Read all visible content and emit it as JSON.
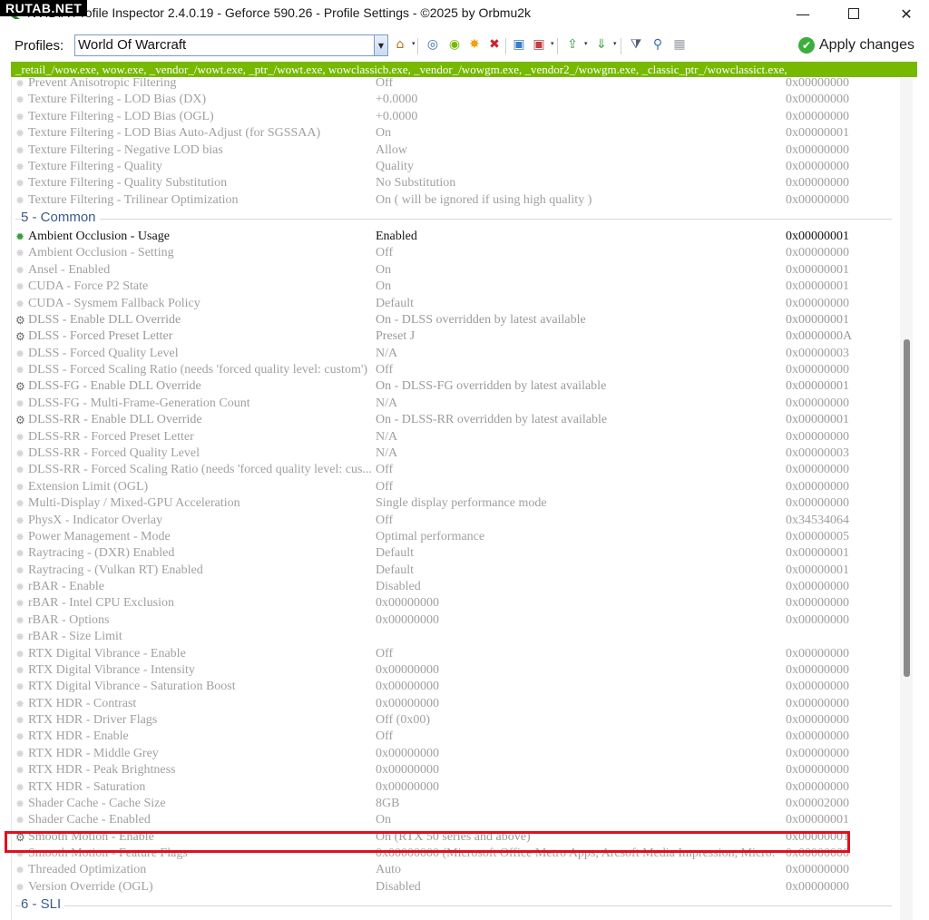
{
  "watermark": "RUTAB.NET",
  "window": {
    "title": "NVIDIA Profile Inspector 2.4.0.19 - Geforce 590.26 - Profile Settings - ©2025 by Orbmu2k",
    "min_glyph": "—",
    "close_glyph": "✕"
  },
  "toolbar": {
    "profiles_label": "Profiles:",
    "profile_value": "World Of Warcraft",
    "combo_arrow": "▼",
    "apply_label": "Apply changes",
    "apply_glyph": "✔",
    "icons": [
      {
        "name": "home-icon",
        "glyph": "⌂",
        "color": "#b07020",
        "dropdown": true
      },
      {
        "name": "detect-profile-icon",
        "glyph": "◎",
        "color": "#3a6ea8",
        "dropdown": false
      },
      {
        "name": "nvidia-icon",
        "glyph": "◉",
        "color": "#76b900",
        "dropdown": false
      },
      {
        "name": "new-profile-icon",
        "glyph": "✸",
        "color": "#f0a010",
        "dropdown": false
      },
      {
        "name": "delete-profile-icon",
        "glyph": "✖",
        "color": "#d0202a",
        "dropdown": false
      },
      {
        "name": "add-application-icon",
        "glyph": "▣",
        "color": "#3a7ec8",
        "dropdown": false
      },
      {
        "name": "remove-application-icon",
        "glyph": "▣",
        "color": "#c04040",
        "dropdown": true
      },
      {
        "name": "export-icon",
        "glyph": "⇪",
        "color": "#3aa040",
        "dropdown": true
      },
      {
        "name": "import-icon",
        "glyph": "⇓",
        "color": "#3aa040",
        "dropdown": true
      },
      {
        "name": "filter-icon",
        "glyph": "⧩",
        "color": "#506070",
        "dropdown": false
      },
      {
        "name": "scan-icon",
        "glyph": "⚲",
        "color": "#3a6ea8",
        "dropdown": false
      },
      {
        "name": "bit-editor-icon",
        "glyph": "▦",
        "color": "#9aa0a8",
        "dropdown": false
      }
    ]
  },
  "executables": "_retail_/wow.exe, wow.exe, _vendor_/wowt.exe, _ptr_/wowt.exe, wowclassicb.exe, _vendor_/wowgm.exe, _vendor2_/wowgm.exe, _classic_ptr_/wowclassict.exe,",
  "settings": {
    "icons": {
      "dim": "✹",
      "active": "✹",
      "gear": "⚙"
    },
    "top_rows": [
      {
        "name": "Prevent Anisotropic Filtering",
        "value": "Off",
        "hex": "0x00000000",
        "state": "dim"
      },
      {
        "name": "Texture Filtering - LOD Bias (DX)",
        "value": "+0.0000",
        "hex": "0x00000000",
        "state": "dim"
      },
      {
        "name": "Texture Filtering - LOD Bias (OGL)",
        "value": "+0.0000",
        "hex": "0x00000000",
        "state": "dim"
      },
      {
        "name": "Texture Filtering - LOD Bias Auto-Adjust (for SGSSAA)",
        "value": "On",
        "hex": "0x00000001",
        "state": "dim"
      },
      {
        "name": "Texture Filtering - Negative LOD bias",
        "value": "Allow",
        "hex": "0x00000000",
        "state": "dim"
      },
      {
        "name": "Texture Filtering - Quality",
        "value": "Quality",
        "hex": "0x00000000",
        "state": "dim"
      },
      {
        "name": "Texture Filtering - Quality Substitution",
        "value": "No Substitution",
        "hex": "0x00000000",
        "state": "dim"
      },
      {
        "name": "Texture Filtering - Trilinear Optimization",
        "value": "On ( will be ignored if using high quality )",
        "hex": "0x00000000",
        "state": "dim"
      }
    ],
    "group_common": "5 - Common",
    "common_rows": [
      {
        "name": "Ambient Occlusion  - Usage",
        "value": "Enabled",
        "hex": "0x00000001",
        "state": "active"
      },
      {
        "name": "Ambient Occlusion - Setting",
        "value": "Off",
        "hex": "0x00000000",
        "state": "dim"
      },
      {
        "name": "Ansel - Enabled",
        "value": "On",
        "hex": "0x00000001",
        "state": "dim"
      },
      {
        "name": "CUDA - Force P2 State",
        "value": "On",
        "hex": "0x00000001",
        "state": "dim"
      },
      {
        "name": "CUDA - Sysmem Fallback Policy",
        "value": "Default",
        "hex": "0x00000000",
        "state": "dim"
      },
      {
        "name": "DLSS - Enable DLL Override",
        "value": "On - DLSS overridden by latest available",
        "hex": "0x00000001",
        "state": "gear"
      },
      {
        "name": "DLSS - Forced Preset Letter",
        "value": "Preset J",
        "hex": "0x0000000A",
        "state": "gear"
      },
      {
        "name": "DLSS - Forced Quality Level",
        "value": "N/A",
        "hex": "0x00000003",
        "state": "dim"
      },
      {
        "name": "DLSS - Forced Scaling Ratio (needs 'forced quality level: custom')",
        "value": "Off",
        "hex": "0x00000000",
        "state": "dim"
      },
      {
        "name": "DLSS-FG - Enable DLL Override",
        "value": "On - DLSS-FG overridden by latest available",
        "hex": "0x00000001",
        "state": "gear"
      },
      {
        "name": "DLSS-FG - Multi-Frame-Generation Count",
        "value": "N/A",
        "hex": "0x00000000",
        "state": "dim"
      },
      {
        "name": "DLSS-RR - Enable DLL Override",
        "value": "On - DLSS-RR overridden by latest available",
        "hex": "0x00000001",
        "state": "gear"
      },
      {
        "name": "DLSS-RR - Forced Preset Letter",
        "value": "N/A",
        "hex": "0x00000000",
        "state": "dim"
      },
      {
        "name": "DLSS-RR - Forced Quality Level",
        "value": "N/A",
        "hex": "0x00000003",
        "state": "dim"
      },
      {
        "name": "DLSS-RR - Forced Scaling Ratio (needs 'forced quality level: cus...",
        "value": "Off",
        "hex": "0x00000000",
        "state": "dim"
      },
      {
        "name": "Extension Limit (OGL)",
        "value": "Off",
        "hex": "0x00000000",
        "state": "dim"
      },
      {
        "name": "Multi-Display / Mixed-GPU Acceleration",
        "value": "Single display performance mode",
        "hex": "0x00000000",
        "state": "dim"
      },
      {
        "name": "PhysX - Indicator Overlay",
        "value": "Off",
        "hex": "0x34534064",
        "state": "dim"
      },
      {
        "name": "Power Management - Mode",
        "value": "Optimal performance",
        "hex": "0x00000005",
        "state": "dim"
      },
      {
        "name": "Raytracing - (DXR) Enabled",
        "value": "Default",
        "hex": "0x00000001",
        "state": "dim"
      },
      {
        "name": "Raytracing - (Vulkan RT) Enabled",
        "value": "Default",
        "hex": "0x00000001",
        "state": "dim"
      },
      {
        "name": "rBAR - Enable",
        "value": "Disabled",
        "hex": "0x00000000",
        "state": "dim"
      },
      {
        "name": "rBAR - Intel CPU Exclusion",
        "value": "0x00000000",
        "hex": "0x00000000",
        "state": "dim"
      },
      {
        "name": "rBAR - Options",
        "value": "0x00000000",
        "hex": "0x00000000",
        "state": "dim"
      },
      {
        "name": "rBAR - Size Limit",
        "value": "",
        "hex": "",
        "state": "dim"
      },
      {
        "name": "RTX Digital Vibrance - Enable",
        "value": "Off",
        "hex": "0x00000000",
        "state": "dim"
      },
      {
        "name": "RTX Digital Vibrance - Intensity",
        "value": "0x00000000",
        "hex": "0x00000000",
        "state": "dim"
      },
      {
        "name": "RTX Digital Vibrance - Saturation Boost",
        "value": "0x00000000",
        "hex": "0x00000000",
        "state": "dim"
      },
      {
        "name": "RTX HDR - Contrast",
        "value": "0x00000000",
        "hex": "0x00000000",
        "state": "dim"
      },
      {
        "name": "RTX HDR - Driver Flags",
        "value": "Off (0x00)",
        "hex": "0x00000000",
        "state": "dim"
      },
      {
        "name": "RTX HDR - Enable",
        "value": "Off",
        "hex": "0x00000000",
        "state": "dim"
      },
      {
        "name": "RTX HDR - Middle Grey",
        "value": "0x00000000",
        "hex": "0x00000000",
        "state": "dim"
      },
      {
        "name": "RTX HDR - Peak Brightness",
        "value": "0x00000000",
        "hex": "0x00000000",
        "state": "dim"
      },
      {
        "name": "RTX HDR - Saturation",
        "value": "0x00000000",
        "hex": "0x00000000",
        "state": "dim"
      },
      {
        "name": "Shader Cache - Cache Size",
        "value": "8GB",
        "hex": "0x00002000",
        "state": "dim"
      },
      {
        "name": "Shader Cache - Enabled",
        "value": "On",
        "hex": "0x00000001",
        "state": "dim"
      },
      {
        "name": "Smooth Motion - Enable",
        "value": "On (RTX 50 series and above)",
        "hex": "0x00000001",
        "state": "gear-only"
      },
      {
        "name": "Smooth Motion - Feature Flags",
        "value": "0x00000000 (Microsoft Office Metro Apps, Arcsoft Media Impression, Micro...",
        "hex": "0x00000000",
        "state": "dim"
      },
      {
        "name": "Threaded Optimization",
        "value": "Auto",
        "hex": "0x00000000",
        "state": "dim"
      },
      {
        "name": "Version Override (OGL)",
        "value": "Disabled",
        "hex": "0x00000000",
        "state": "dim"
      }
    ],
    "group_sli": "6 - SLI"
  }
}
